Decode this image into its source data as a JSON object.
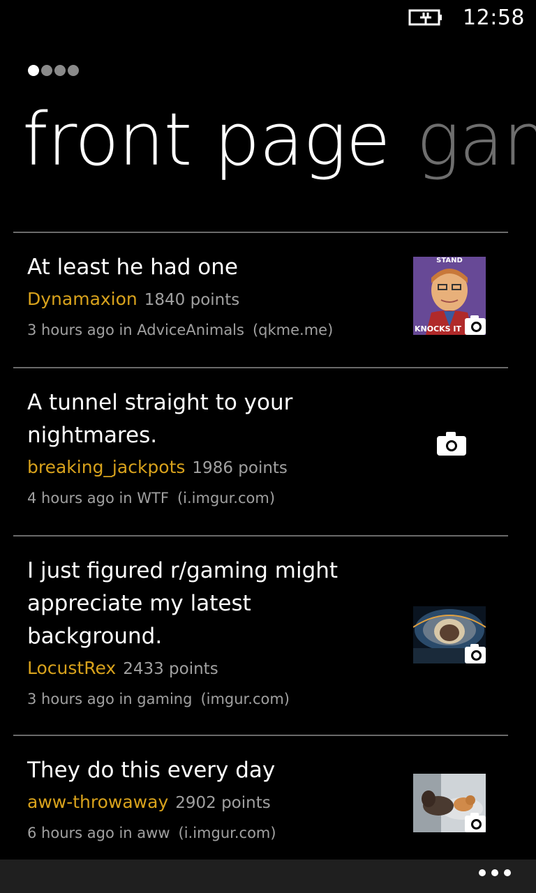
{
  "status_bar": {
    "time": "12:58",
    "battery_icon": "battery-charging-icon"
  },
  "pivot": {
    "dots_count": 4,
    "active_dot_index": 0,
    "current_title": "front page",
    "next_title": "gam"
  },
  "posts": [
    {
      "title": "At least he had one",
      "author": "Dynamaxion",
      "points": "1840 points",
      "time_subreddit": "3 hours ago in AdviceAnimals",
      "domain": "(qkme.me)",
      "thumbnail": "bad-luck-brian-meme",
      "thumb_text_top": "STAND",
      "thumb_text_bottom": "KNOCKS IT"
    },
    {
      "title": "A tunnel straight to your nightmares.",
      "author": "breaking_jackpots",
      "points": "1986 points",
      "time_subreddit": "4 hours ago in WTF",
      "domain": "(i.imgur.com)",
      "thumbnail": "camera-icon"
    },
    {
      "title": "I just figured r/gaming might appreciate my latest background.",
      "author": "LocustRex",
      "points": "2433 points",
      "time_subreddit": "3 hours ago in gaming",
      "domain": "(imgur.com)",
      "thumbnail": "space-helmet-image"
    },
    {
      "title": "They do this every day",
      "author": "aww-throwaway",
      "points": "2902 points",
      "time_subreddit": "6 hours ago in aww",
      "domain": "(i.imgur.com)",
      "thumbnail": "dog-cat-image"
    }
  ],
  "app_bar": {
    "more_icon": "ellipsis-icon"
  },
  "colors": {
    "background": "#000000",
    "accent": "#d8a21c",
    "secondary_text": "#a0a0a0",
    "divider": "#6a6a6a",
    "app_bar": "#1f1f1f"
  }
}
